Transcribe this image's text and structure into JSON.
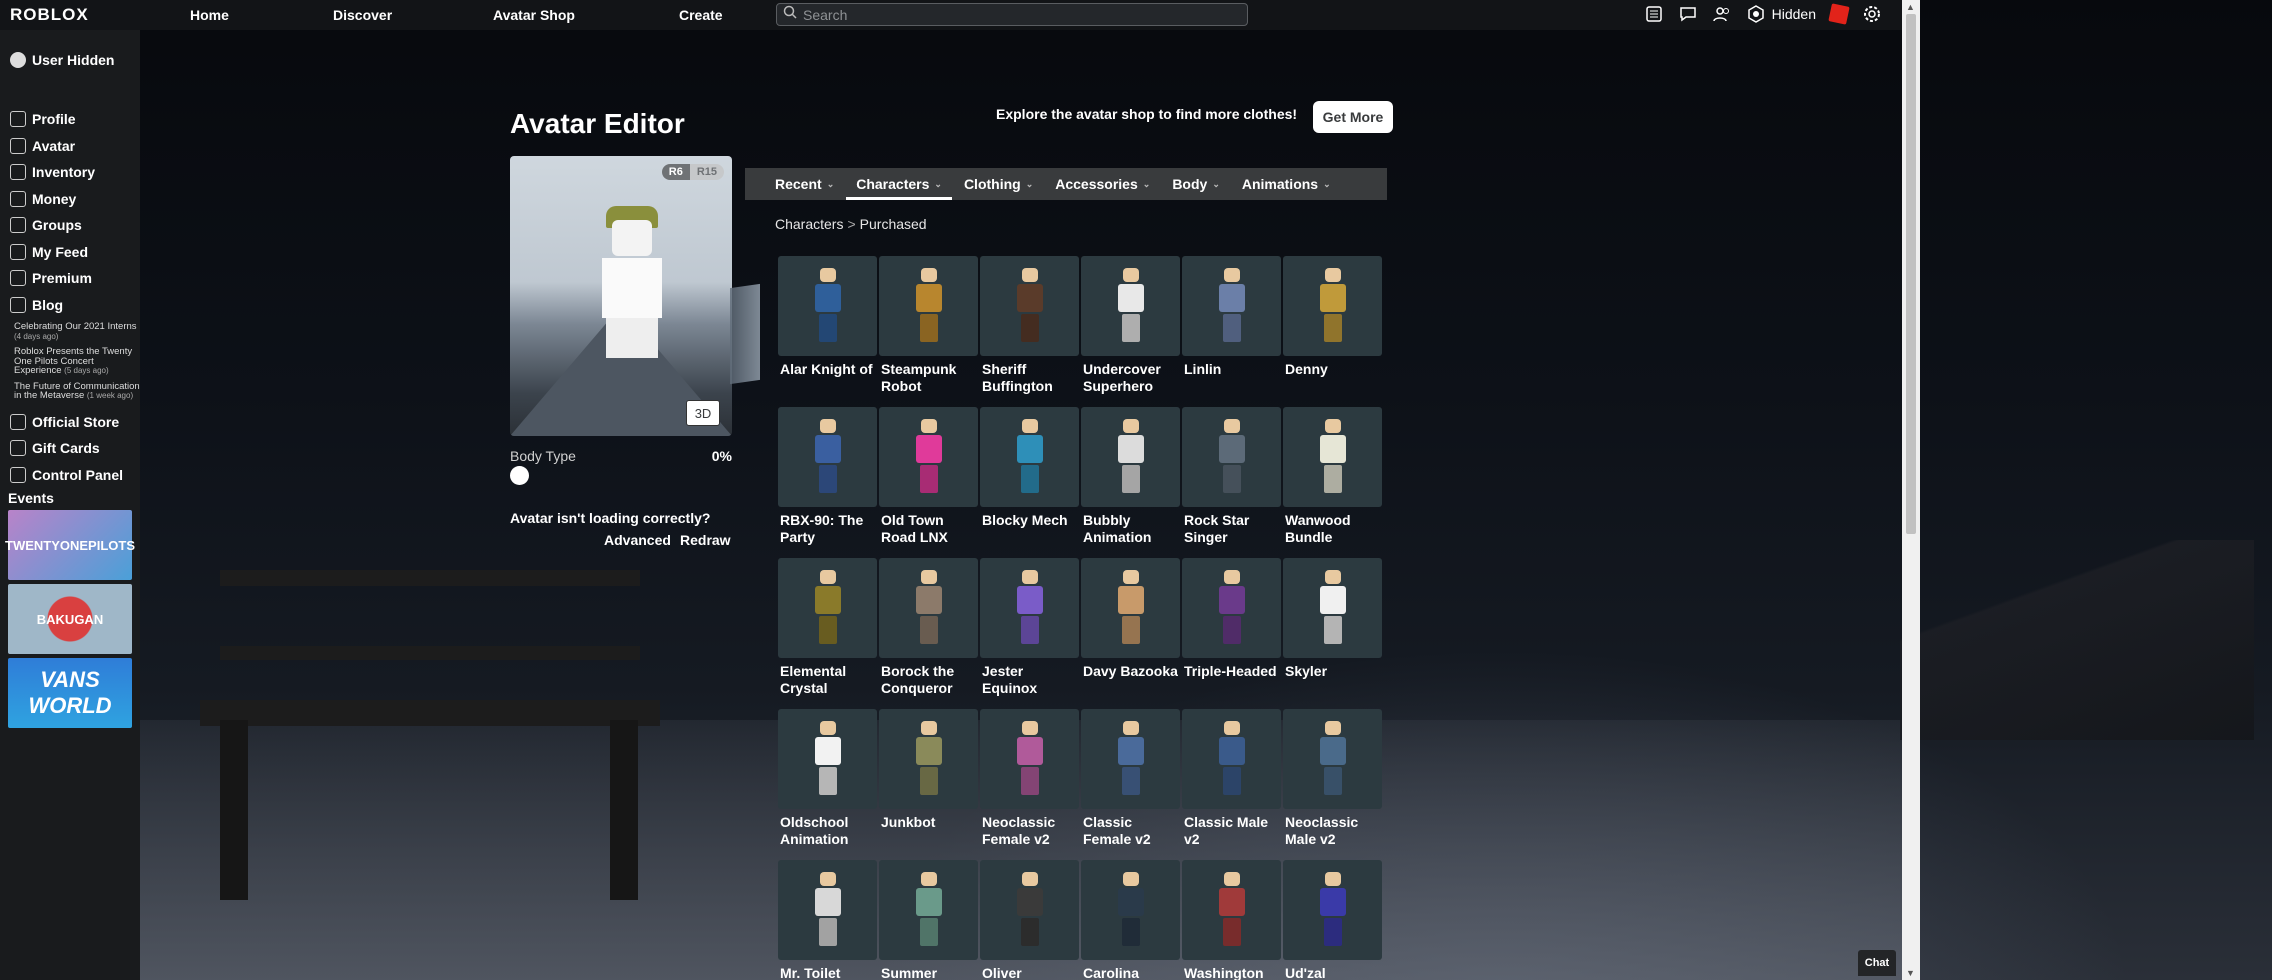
{
  "nav": {
    "logo": "ROBLOX",
    "links": [
      "Home",
      "Discover",
      "Avatar Shop",
      "Create"
    ],
    "search_placeholder": "Search",
    "robux_label": "Hidden"
  },
  "sidebar": {
    "username": "User Hidden",
    "items": [
      "Profile",
      "Avatar",
      "Inventory",
      "Money",
      "Groups",
      "My Feed",
      "Premium",
      "Blog"
    ],
    "blog_posts": [
      {
        "title": "Celebrating Our 2021 Interns",
        "ago": "(4 days ago)"
      },
      {
        "title": "Roblox Presents the Twenty One Pilots Concert Experience",
        "ago": "(5 days ago)"
      },
      {
        "title": "The Future of Communication in the Metaverse",
        "ago": "(1 week ago)"
      }
    ],
    "items_after": [
      "Official Store",
      "Gift Cards",
      "Control Panel"
    ],
    "events_label": "Events",
    "events": [
      "TWENTYONEPILOTS",
      "BAKUGAN",
      "VANS WORLD"
    ]
  },
  "editor": {
    "title": "Avatar Editor",
    "promo": "Explore the avatar shop to find more clothes!",
    "get_more": "Get More",
    "rig_r6": "R6",
    "rig_r15": "R15",
    "view_3d": "3D",
    "body_type_label": "Body Type",
    "body_type_value": "0%",
    "loading_question": "Avatar isn't loading correctly?",
    "advanced": "Advanced",
    "redraw": "Redraw"
  },
  "tabs": [
    {
      "label": "Recent",
      "active": false
    },
    {
      "label": "Characters",
      "active": true
    },
    {
      "label": "Clothing",
      "active": false
    },
    {
      "label": "Accessories",
      "active": false
    },
    {
      "label": "Body",
      "active": false
    },
    {
      "label": "Animations",
      "active": false
    }
  ],
  "breadcrumb": {
    "parent": "Characters",
    "separator": ">",
    "current": "Purchased"
  },
  "items": [
    {
      "name": "Alar Knight of",
      "color": "#2f5f9a"
    },
    {
      "name": "Steampunk Robot",
      "color": "#b8862e"
    },
    {
      "name": "Sheriff Buffington",
      "color": "#5a3b2a"
    },
    {
      "name": "Undercover Superhero",
      "color": "#e8e8e8"
    },
    {
      "name": "Linlin",
      "color": "#6b7fa8"
    },
    {
      "name": "Denny",
      "color": "#c09a3a"
    },
    {
      "name": "RBX-90: The Party",
      "color": "#3a5fa0"
    },
    {
      "name": "Old Town Road LNX",
      "color": "#e03a9a"
    },
    {
      "name": "Blocky Mech",
      "color": "#2e8fb8"
    },
    {
      "name": "Bubbly Animation",
      "color": "#dcdcdc"
    },
    {
      "name": "Rock Star Singer",
      "color": "#5c6a78"
    },
    {
      "name": "Wanwood Bundle",
      "color": "#e6e6d6"
    },
    {
      "name": "Elemental Crystal",
      "color": "#8a7a2a"
    },
    {
      "name": "Borock the Conqueror",
      "color": "#8c7a6a"
    },
    {
      "name": "Jester Equinox",
      "color": "#7a5cc8"
    },
    {
      "name": "Davy Bazooka",
      "color": "#c89a6a"
    },
    {
      "name": "Triple-Headed",
      "color": "#6a3a8a"
    },
    {
      "name": "Skyler",
      "color": "#f0f0f0"
    },
    {
      "name": "Oldschool Animation",
      "color": "#f2f2f2"
    },
    {
      "name": "Junkbot",
      "color": "#8a8a5a"
    },
    {
      "name": "Neoclassic Female v2",
      "color": "#b05a9a"
    },
    {
      "name": "Classic Female v2",
      "color": "#4a6a9a"
    },
    {
      "name": "Classic Male v2",
      "color": "#3a5a8a"
    },
    {
      "name": "Neoclassic Male v2",
      "color": "#4a6a8a"
    },
    {
      "name": "Mr. Toilet",
      "color": "#d8d8d8"
    },
    {
      "name": "Summer",
      "color": "#6a9a8a"
    },
    {
      "name": "Oliver",
      "color": "#3a3a3a"
    },
    {
      "name": "Carolina",
      "color": "#2a3a4a"
    },
    {
      "name": "Washington",
      "color": "#a03a3a"
    },
    {
      "name": "Ud'zal",
      "color": "#3a3aa8"
    }
  ],
  "chat_label": "Chat"
}
